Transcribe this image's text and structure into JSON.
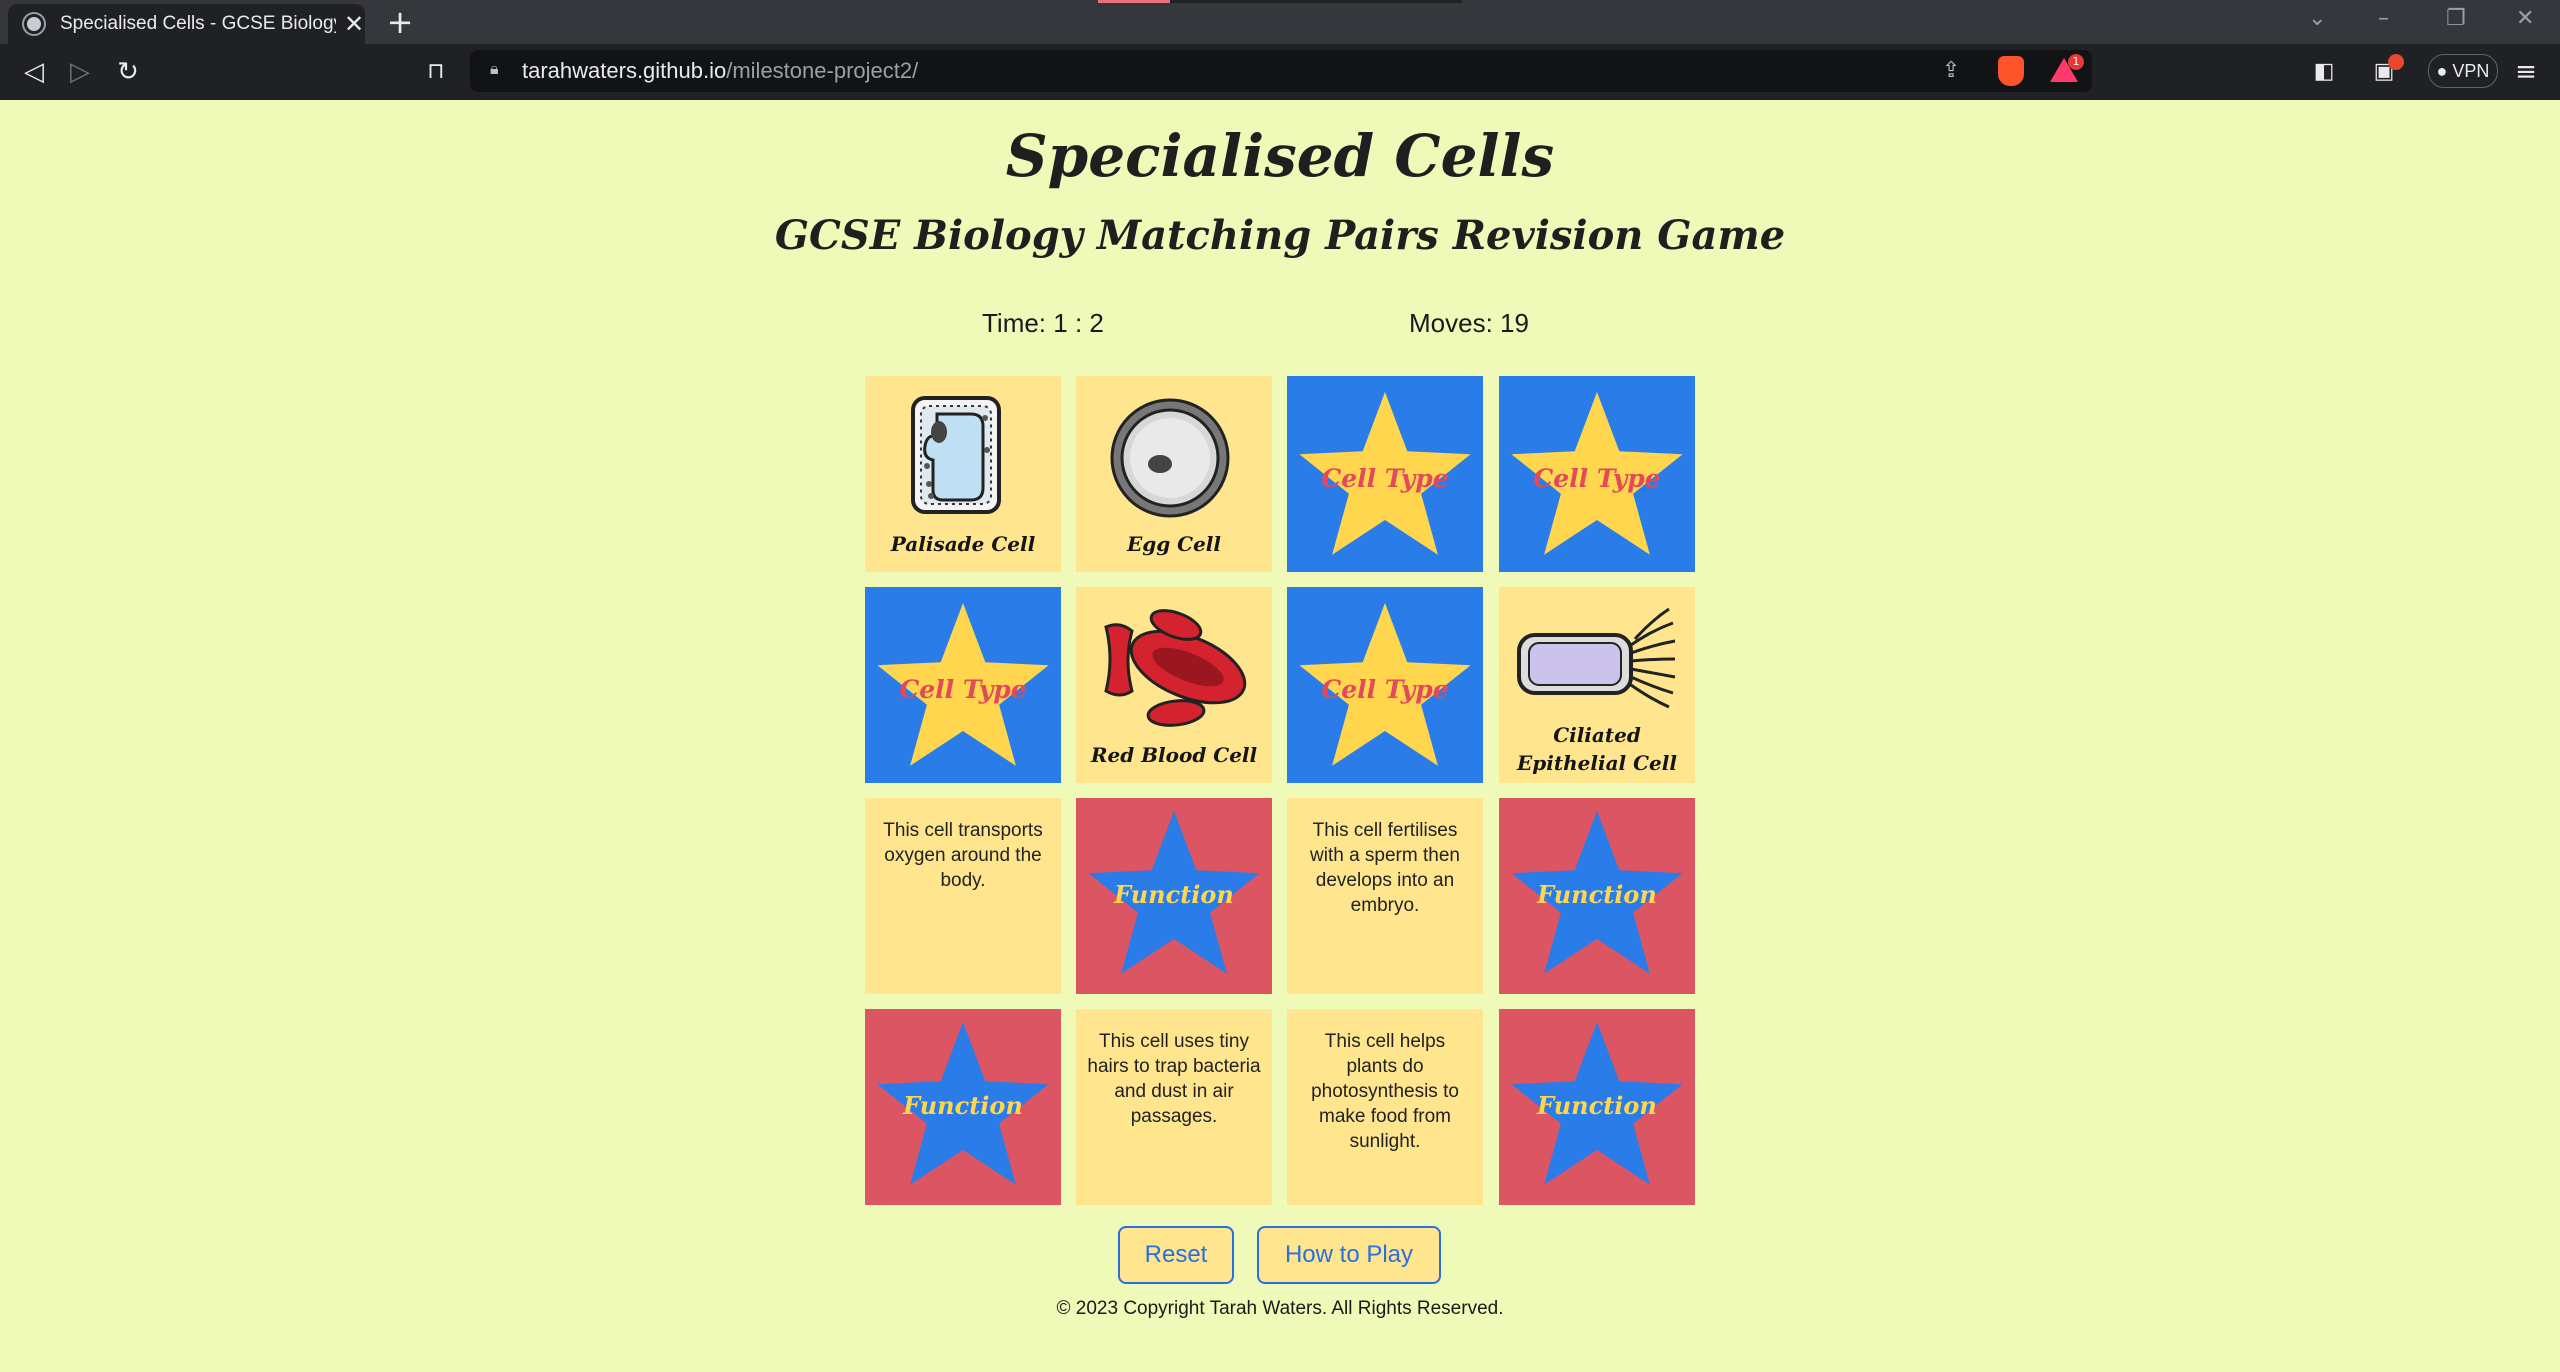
{
  "browser": {
    "tab_title": "Specialised Cells - GCSE Biology R",
    "tab_close": "✕",
    "new_tab": "+",
    "url_host": "tarahwaters.github.io",
    "url_path": "/milestone-project2/",
    "vpn_label": "VPN",
    "alert_badge": "1"
  },
  "page": {
    "title": "Specialised Cells",
    "subtitle": "GCSE Biology Matching Pairs Revision Game"
  },
  "stats": {
    "timer": "Time: 1 : 2",
    "moves": "Moves: 19"
  },
  "cards": [
    {
      "state": "front-cell",
      "name": "Palisade Cell",
      "icon": "palisade-cell-icon"
    },
    {
      "state": "front-cell",
      "name": "Egg Cell",
      "icon": "egg-cell-icon"
    },
    {
      "state": "back-type",
      "label": "Cell Type"
    },
    {
      "state": "back-type",
      "label": "Cell Type"
    },
    {
      "state": "back-type",
      "label": "Cell Type"
    },
    {
      "state": "front-cell",
      "name": "Red Blood Cell",
      "icon": "red-blood-cell-icon"
    },
    {
      "state": "back-type",
      "label": "Cell Type"
    },
    {
      "state": "front-cell",
      "name": "Ciliated Epithelial Cell",
      "icon": "ciliated-cell-icon"
    },
    {
      "state": "front-func",
      "text": "This cell transports oxygen around the body."
    },
    {
      "state": "back-func",
      "label": "Function"
    },
    {
      "state": "front-func",
      "text": "This cell fertilises with a sperm then develops into an embryo."
    },
    {
      "state": "back-func",
      "label": "Function"
    },
    {
      "state": "back-func",
      "label": "Function"
    },
    {
      "state": "front-func",
      "text": "This cell uses tiny hairs to trap bacteria and dust in air passages."
    },
    {
      "state": "front-func",
      "text": "This cell helps plants do photosynthesis to make food from sunlight."
    },
    {
      "state": "back-func",
      "label": "Function"
    }
  ],
  "buttons": {
    "reset": "Reset",
    "how_to_play": "How to Play"
  },
  "footer": "© 2023 Copyright Tarah Waters. All Rights Reserved.",
  "colors": {
    "background": "#eff9b8",
    "card_front": "#ffe58e",
    "type_back": "#2a7de9",
    "func_back": "#db5563",
    "star_yellow": "#ffd64e",
    "accent_blue": "#2a6fe0"
  }
}
